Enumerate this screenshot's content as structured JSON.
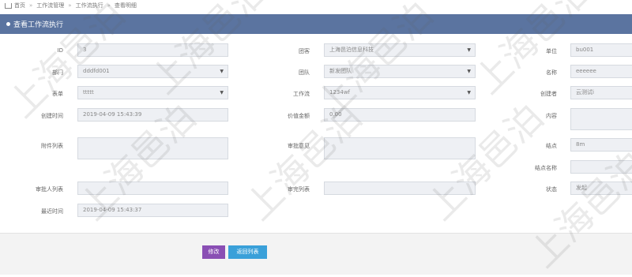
{
  "breadcrumb": {
    "items": [
      "首页",
      "工作流管理",
      "工作流执行",
      "查看明细"
    ]
  },
  "panel": {
    "title": "查看工作流执行"
  },
  "fields": {
    "id": {
      "label": "ID",
      "value": "3"
    },
    "tenant": {
      "label": "团客",
      "value": "上海邑泊信息科技"
    },
    "unit": {
      "label": "单位",
      "value": "bu001"
    },
    "dept": {
      "label": "部门",
      "value": "dddfd001"
    },
    "team": {
      "label": "团队",
      "value": "新发团队"
    },
    "name": {
      "label": "名称",
      "value": "eeeeee"
    },
    "form": {
      "label": "表单",
      "value": "ttttt"
    },
    "workflow": {
      "label": "工作流",
      "value": "1234wf"
    },
    "creator": {
      "label": "创建者",
      "value": "云测试i"
    },
    "created_at": {
      "label": "创建时间",
      "value": "2019-04-09 15:43:39"
    },
    "amount": {
      "label": "价值金额",
      "value": "0.00"
    },
    "content": {
      "label": "内容",
      "value": ""
    },
    "attachments": {
      "label": "附件列表",
      "value": ""
    },
    "opinion": {
      "label": "审批意见",
      "value": ""
    },
    "node": {
      "label": "结点",
      "value": "8m"
    },
    "node_name": {
      "label": "结点名称",
      "value": ""
    },
    "approvers": {
      "label": "审批人列表",
      "value": ""
    },
    "reviewed": {
      "label": "审完列表",
      "value": ""
    },
    "status": {
      "label": "状态",
      "value": "发起"
    },
    "updated_at": {
      "label": "最近时间",
      "value": "2019-04-09 15:43:37"
    }
  },
  "buttons": {
    "edit": "修改",
    "back": "返回列表"
  },
  "watermark": "上海邑泊"
}
